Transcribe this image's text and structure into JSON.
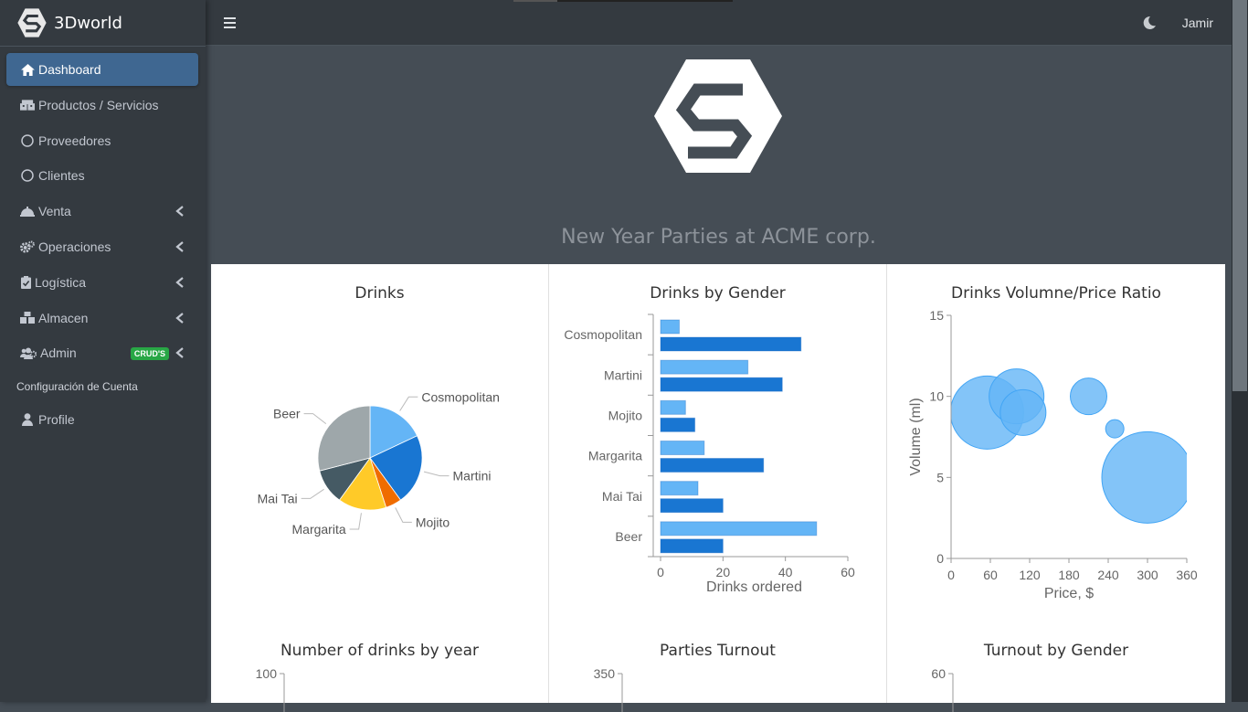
{
  "brand": {
    "name": "3Dworld"
  },
  "sidebar": {
    "items": [
      {
        "label": "Dashboard",
        "icon": "home-icon"
      },
      {
        "label": "Productos / Servicios",
        "icon": "boxes-icon"
      },
      {
        "label": "Proveedores",
        "icon": "circle-icon"
      },
      {
        "label": "Clientes",
        "icon": "circle-icon"
      },
      {
        "label": "Venta",
        "icon": "concierge-bell-icon"
      },
      {
        "label": "Operaciones",
        "icon": "cogs-icon"
      },
      {
        "label": "Logística",
        "icon": "clipboard-check-icon"
      },
      {
        "label": "Almacen",
        "icon": "warehouse-icon"
      },
      {
        "label": "Admin",
        "icon": "users-cog-icon",
        "badge": "CRUD'S"
      }
    ],
    "section_header": "Configuración de Cuenta",
    "profile_label": "Profile"
  },
  "topbar": {
    "user": "Jamir"
  },
  "hero": {
    "title": "New Year Parties at ACME corp."
  },
  "colors": {
    "accent": "#3f6791",
    "badge": "#28a745",
    "bubble": "#64b5f6",
    "bar_light": "#64b5f6",
    "bar_dark": "#1976d2"
  },
  "chart_data": [
    {
      "type": "pie",
      "title": "Drinks",
      "categories": [
        "Cosmopolitan",
        "Martini",
        "Mojito",
        "Margarita",
        "Mai Tai",
        "Beer"
      ],
      "values": [
        18,
        22,
        5,
        15,
        11,
        29
      ],
      "colors": [
        "#64b5f6",
        "#1976d2",
        "#ef6c00",
        "#ffca28",
        "#455a64",
        "#9ea7aa"
      ]
    },
    {
      "type": "bar",
      "title": "Drinks by Gender",
      "categories": [
        "Cosmopolitan",
        "Martini",
        "Mojito",
        "Margarita",
        "Mai Tai",
        "Beer"
      ],
      "series": [
        {
          "values": [
            6,
            28,
            8,
            14,
            12,
            50
          ]
        },
        {
          "values": [
            45,
            39,
            11,
            33,
            20,
            20
          ]
        }
      ],
      "xlabel": "Drinks ordered",
      "xlim": [
        0,
        60
      ],
      "xticks": [
        "0",
        "20",
        "40",
        "60"
      ]
    },
    {
      "type": "scatter",
      "title": "Drinks Volumne/Price Ratio",
      "xlabel": "Price, $",
      "ylabel": "Volume (ml)",
      "xlim": [
        0,
        360
      ],
      "ylim": [
        0,
        15
      ],
      "xticks": [
        "0",
        "60",
        "120",
        "180",
        "240",
        "300",
        "360"
      ],
      "yticks": [
        "0",
        "5",
        "10",
        "15"
      ],
      "points": [
        {
          "x": 55,
          "y": 9,
          "r": 40
        },
        {
          "x": 100,
          "y": 10,
          "r": 30
        },
        {
          "x": 110,
          "y": 9,
          "r": 25
        },
        {
          "x": 210,
          "y": 10,
          "r": 20
        },
        {
          "x": 250,
          "y": 8,
          "r": 10
        },
        {
          "x": 300,
          "y": 5,
          "r": 50
        }
      ]
    },
    {
      "type": "bar",
      "title": "Number of drinks by year",
      "yticks": [
        "100"
      ]
    },
    {
      "type": "bar",
      "title": "Parties Turnout",
      "yticks": [
        "350"
      ]
    },
    {
      "type": "bar",
      "title": "Turnout by Gender",
      "yticks": [
        "60"
      ]
    }
  ]
}
